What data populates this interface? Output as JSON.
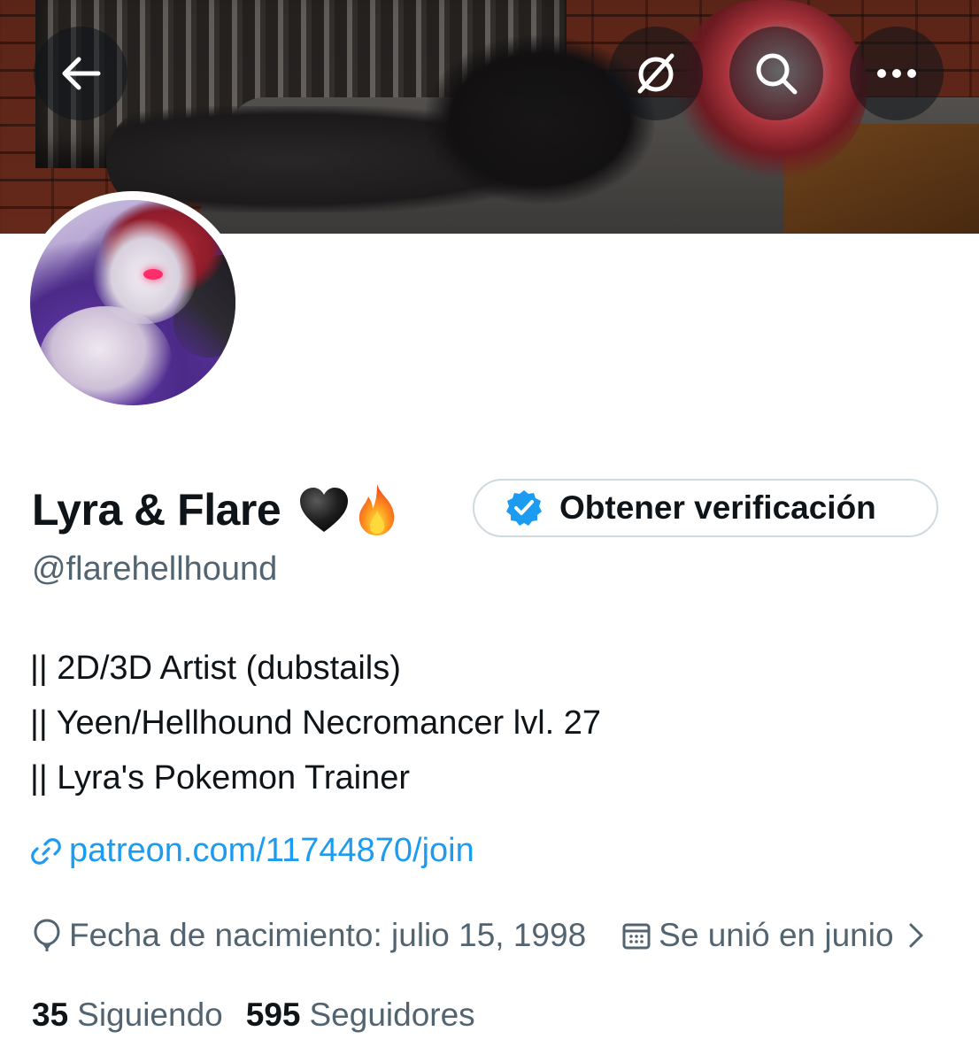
{
  "header": {
    "back_icon": "arrow-left-icon",
    "grok_icon": "grok-icon",
    "search_icon": "search-icon",
    "more_icon": "more-horizontal-icon"
  },
  "profile": {
    "display_name": "Lyra & Flare",
    "name_emojis": [
      "🖤",
      "🔥"
    ],
    "handle": "@flarehellhound",
    "verify_button_label": "Obtener verificación",
    "bio_lines": [
      "|| 2D/3D Artist (dubstails)",
      "|| Yeen/Hellhound Necromancer lvl. 27",
      "|| Lyra's Pokemon Trainer"
    ],
    "link": "patreon.com/11744870/join",
    "birthday": "Fecha de nacimiento: julio 15, 1998",
    "joined": "Se unió en junio",
    "following_count": "35",
    "following_label": "Siguiendo",
    "followers_count": "595",
    "followers_label": "Seguidores"
  },
  "colors": {
    "accent": "#1d9bf0",
    "text_primary": "#0f1419",
    "text_secondary": "#536471",
    "border": "#cfd9de"
  }
}
